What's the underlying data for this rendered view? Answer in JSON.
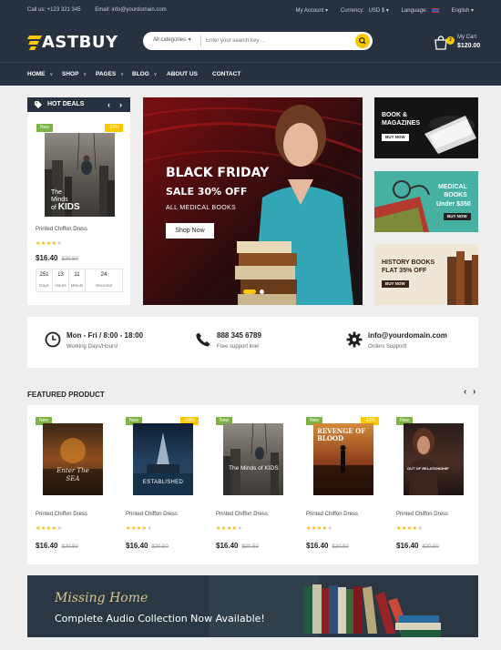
{
  "topbar": {
    "phone": "Call us: +123 321 345",
    "email": "Email: info@yourdomain.com",
    "account": "My Account ▾",
    "currency_label": "Currency:",
    "currency_value": "USD $ ▾",
    "language_label": "Language:",
    "language_value": "English ▾"
  },
  "header": {
    "logo_text": "ASTBUY",
    "search_category": "All categories",
    "search_placeholder": "Enter your search key ...",
    "cart_label": "My Cart",
    "cart_total": "$120.00",
    "cart_count": "2"
  },
  "nav": {
    "items": [
      {
        "label": "HOME"
      },
      {
        "label": "SHOP"
      },
      {
        "label": "PAGES"
      },
      {
        "label": "BLOG"
      },
      {
        "label": "ABOUT US"
      },
      {
        "label": "CONTACT"
      }
    ]
  },
  "hot_deals": {
    "title": "HOT DEALS",
    "new_label": "New",
    "sale_label": "-20%",
    "cover_line1": "The",
    "cover_line2": "Minds",
    "cover_line3": "of",
    "cover_line4": "KIDS",
    "product_name": "Printed Chiffon Dress",
    "rating": 4,
    "price": "$16.40",
    "old_price": "$20.50",
    "countdown": [
      {
        "value": "251",
        "unit": "Days"
      },
      {
        "value": "13",
        "unit": "Hours"
      },
      {
        "value": "11",
        "unit": "Minuts"
      },
      {
        "value": "24",
        "unit": "Seccond"
      }
    ]
  },
  "hero": {
    "line1": "BLACK FRIDAY",
    "line2": "SALE 30% OFF",
    "line3": "ALL MEDICAL BOOKS",
    "button": "Shop Now",
    "active_slide": 1,
    "slides": 2
  },
  "side_banners": [
    {
      "line1": "BOOK &",
      "line2": "MAGAZINES",
      "button": "BUY NOW"
    },
    {
      "line1": "MEDICAL",
      "line2": "BOOKS",
      "line3": "Under $350",
      "button": "BUY NOW"
    },
    {
      "line1": "HISTORY BOOKS",
      "line2": "FLAT 35% OFF",
      "button": "BUY NOW"
    }
  ],
  "info": [
    {
      "title": "Mon - Fri / 8:00 - 18:00",
      "subtitle": "Working Days/Hours!"
    },
    {
      "title": "888 345 6789",
      "subtitle": "Free support line!"
    },
    {
      "title": "info@yourdomain.com",
      "subtitle": "Orders Support!"
    }
  ],
  "featured": {
    "title": "FEATURED PRODUCT",
    "products": [
      {
        "new": "New",
        "sale": "",
        "cover_title": "Enter The SEA",
        "name": "Printed Chiffon Dress",
        "rating": 4,
        "price": "$16.40",
        "old": "$20.50"
      },
      {
        "new": "New",
        "sale": "-20%",
        "cover_title": "ESTABLISHED",
        "name": "Printed Chiffon Dress",
        "rating": 4,
        "price": "$16.40",
        "old": "$20.50"
      },
      {
        "new": "New",
        "sale": "",
        "cover_title": "The Minds of KIDS",
        "name": "Printed Chiffon Dress",
        "rating": 4,
        "price": "$16.40",
        "old": "$20.50"
      },
      {
        "new": "New",
        "sale": "-20%",
        "cover_title": "REVENGE OF BLOOD",
        "name": "Printed Chiffon Dress",
        "rating": 4,
        "price": "$16.40",
        "old": "$20.50"
      },
      {
        "new": "New",
        "sale": "",
        "cover_title": "OUT OF RELATIONSHIP",
        "name": "Printed Chiffon Dress",
        "rating": 4,
        "price": "$16.40",
        "old": "$20.50"
      }
    ]
  },
  "bottom_banner": {
    "title": "Missing Home",
    "subtitle": "Complete Audio Collection Now Available!"
  },
  "colors": {
    "header_bg": "#273140",
    "accent_yellow": "#f9c800",
    "new_green": "#7cb342",
    "star": "#f9b500"
  }
}
